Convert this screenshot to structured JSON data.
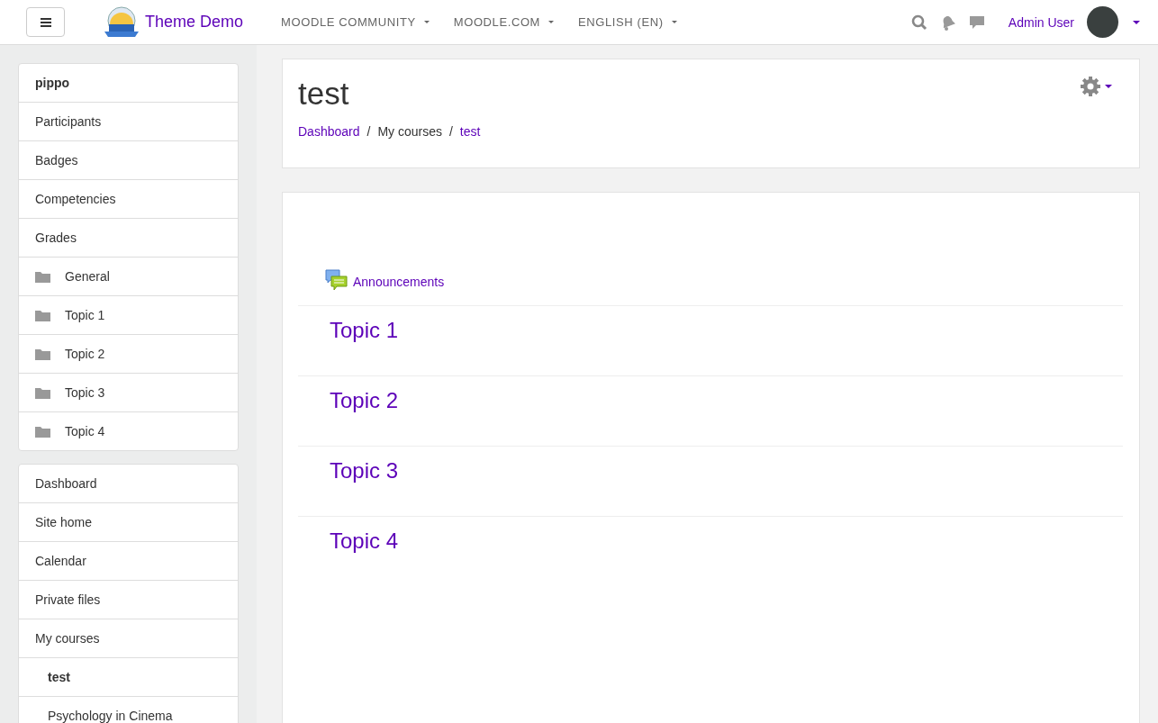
{
  "navbar": {
    "site_name": "Theme Demo",
    "menus": [
      "MOODLE COMMUNITY",
      "MOODLE.COM",
      "ENGLISH (EN)"
    ],
    "user_name": "Admin User"
  },
  "course_block": {
    "title": "pippo",
    "items": [
      {
        "label": "Participants",
        "kind": "link"
      },
      {
        "label": "Badges",
        "kind": "link"
      },
      {
        "label": "Competencies",
        "kind": "link"
      },
      {
        "label": "Grades",
        "kind": "link"
      },
      {
        "label": "General",
        "kind": "folder"
      },
      {
        "label": "Topic 1",
        "kind": "folder"
      },
      {
        "label": "Topic 2",
        "kind": "folder"
      },
      {
        "label": "Topic 3",
        "kind": "folder"
      },
      {
        "label": "Topic 4",
        "kind": "folder"
      }
    ]
  },
  "nav_block": {
    "items": [
      {
        "label": "Dashboard"
      },
      {
        "label": "Site home"
      },
      {
        "label": "Calendar"
      },
      {
        "label": "Private files"
      },
      {
        "label": "My courses",
        "children": [
          {
            "label": "test",
            "selected": true
          },
          {
            "label": "Psychology in Cinema",
            "selected": false
          }
        ]
      }
    ]
  },
  "page_header": {
    "title": "test",
    "breadcrumbs": [
      {
        "label": "Dashboard",
        "link": true
      },
      {
        "label": "My courses",
        "link": false,
        "separator": "/"
      },
      {
        "label": "test",
        "link": true,
        "separator": "/"
      }
    ]
  },
  "course_content": {
    "activity": "Announcements",
    "sections": [
      "Topic 1",
      "Topic 2",
      "Topic 3",
      "Topic 4"
    ]
  }
}
